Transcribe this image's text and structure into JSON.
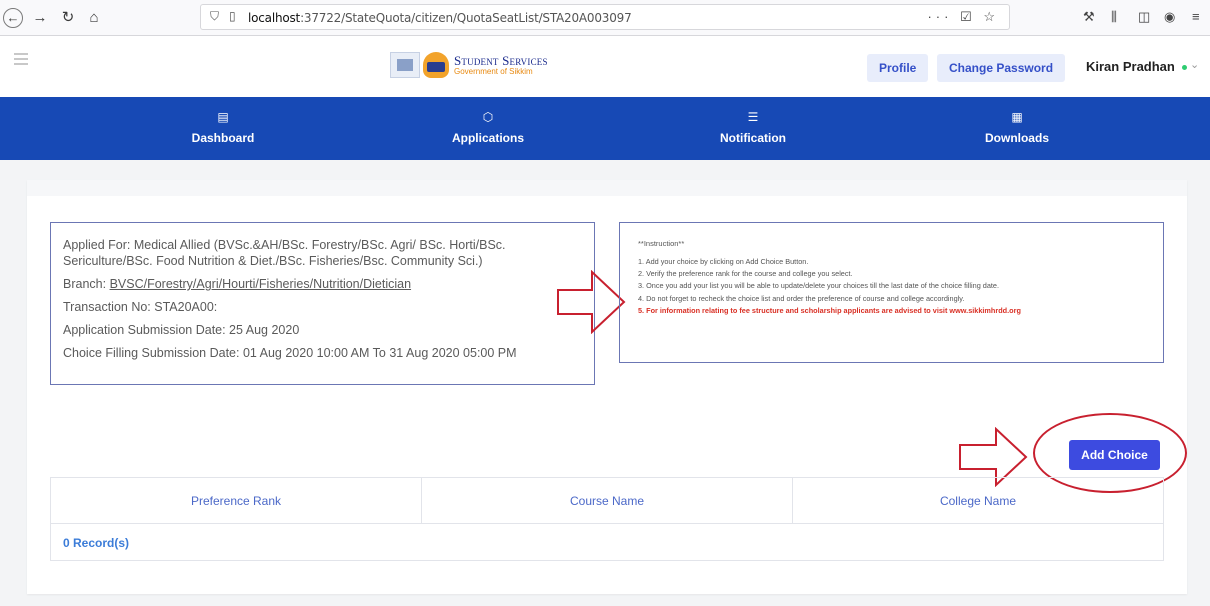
{
  "browser": {
    "url_prefix": "localhost",
    "url_rest": ":37722/StateQuota/citizen/QuotaSeatList/STA20A003097",
    "page_actions": "··· ☑ ☆"
  },
  "header": {
    "logo_title": "Student Services",
    "logo_subtitle": "Government of Sikkim",
    "profile_label": "Profile",
    "change_password_label": "Change Password",
    "user_name": "Kiran Pradhan"
  },
  "nav": {
    "items": [
      {
        "label": "Dashboard",
        "icon": "dashboard-icon"
      },
      {
        "label": "Applications",
        "icon": "applications-icon"
      },
      {
        "label": "Notification",
        "icon": "notification-icon"
      },
      {
        "label": "Downloads",
        "icon": "downloads-icon"
      }
    ]
  },
  "info": {
    "applied_for": "Applied For: Medical Allied (BVSc.&AH/BSc. Forestry/BSc. Agri/ BSc. Horti/BSc. Sericulture/BSc. Food Nutrition & Diet./BSc. Fisheries/Bsc. Community Sci.)",
    "branch_label": "Branch: ",
    "branch_value": "BVSC/Forestry/Agri/Hourti/Fisheries/Nutrition/Dietician",
    "transaction": "Transaction No: STA20A00:",
    "submission_date": "Application Submission Date: 25 Aug 2020",
    "choice_filling": "Choice Filling Submission Date: 01 Aug 2020 10:00 AM To 31 Aug 2020 05:00 PM"
  },
  "instructions": {
    "title": "**Instruction**",
    "lines": [
      "1. Add your choice by clicking on Add Choice Button.",
      "2. Verify the preference rank for the course and college you select.",
      "3. Once you add your list you will be able to update/delete your choices till the last date of the choice filling date.",
      "4. Do not forget to recheck the choice list and order the preference of course and college accordingly."
    ],
    "warning": "5. For information relating to fee structure and scholarship applicants are advised to visit www.sikkimhrdd.org"
  },
  "actions": {
    "add_choice_label": "Add Choice"
  },
  "table": {
    "columns": [
      "Preference Rank",
      "Course Name",
      "College Name"
    ],
    "records_text": "0 Record(s)"
  },
  "colors": {
    "nav_bar": "#1749b5",
    "add_choice": "#3d4be0",
    "annotation": "#c8202f",
    "warning": "#d93025"
  }
}
